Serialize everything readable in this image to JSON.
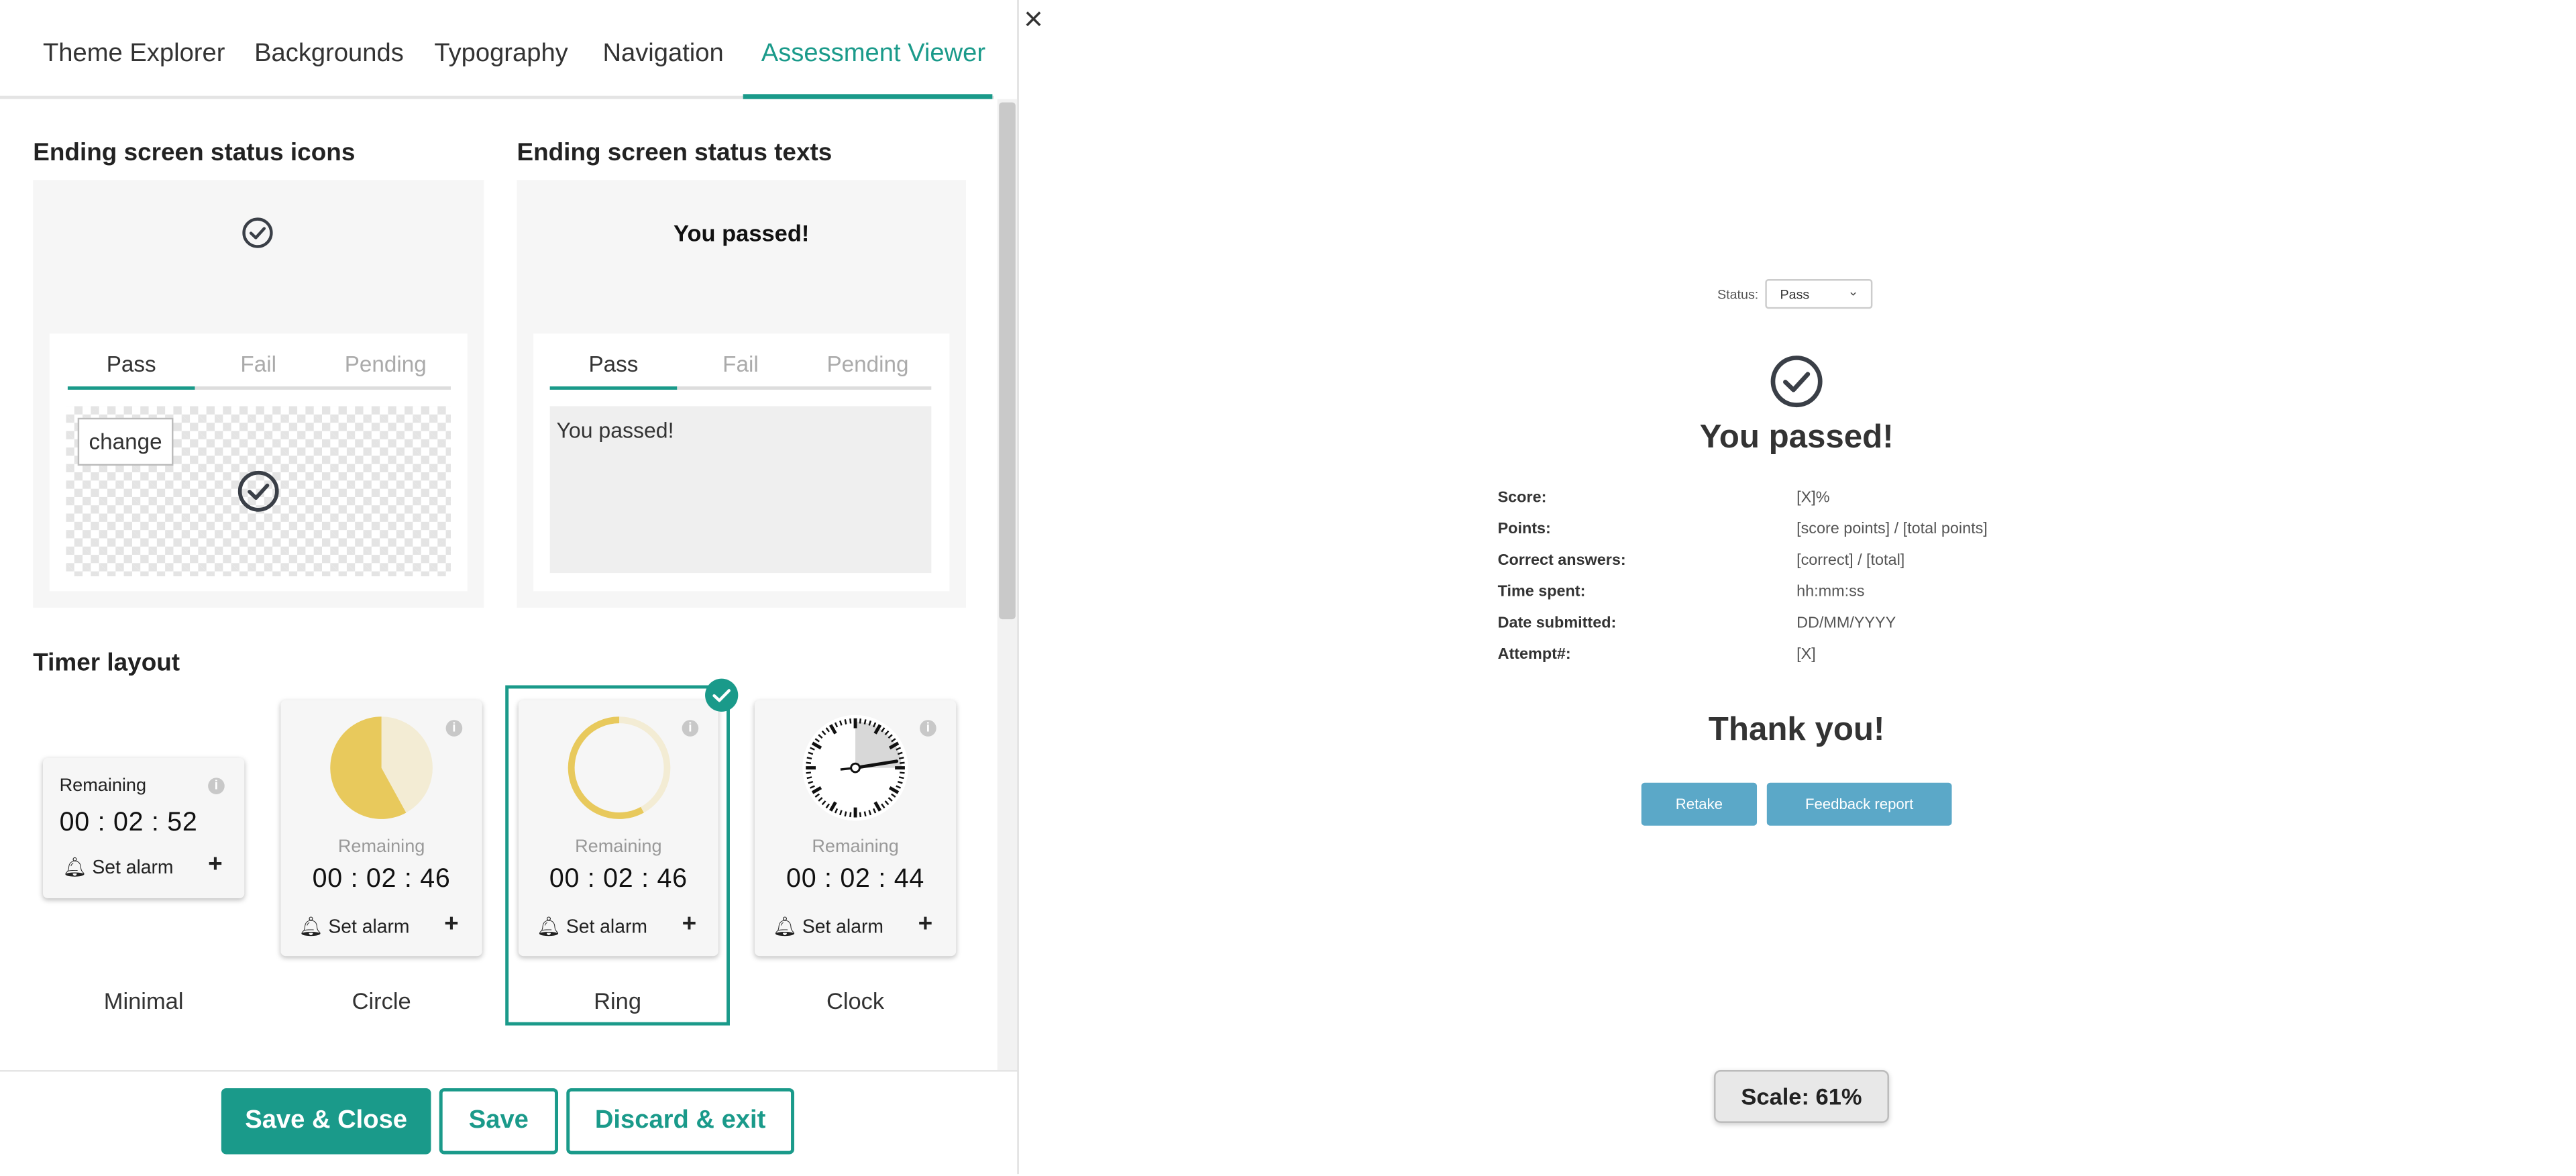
{
  "tabs": [
    "Theme Explorer",
    "Backgrounds",
    "Typography",
    "Navigation",
    "Assessment Viewer"
  ],
  "active_tab": "Assessment Viewer",
  "close_icon": "×",
  "status_icons": {
    "title": "Ending screen status icons",
    "subtabs": [
      "Pass",
      "Fail",
      "Pending"
    ],
    "active_subtab": "Pass",
    "change_label": "change"
  },
  "status_texts": {
    "title": "Ending screen status texts",
    "preview_text": "You passed!",
    "subtabs": [
      "Pass",
      "Fail",
      "Pending"
    ],
    "active_subtab": "Pass",
    "text_value": "You passed!"
  },
  "timer": {
    "title": "Timer layout",
    "layouts": [
      {
        "name": "Minimal",
        "label": "Remaining",
        "time": "00 : 02 : 52",
        "alarm": "Set alarm"
      },
      {
        "name": "Circle",
        "label": "Remaining",
        "time": "00 : 02 : 46",
        "alarm": "Set alarm",
        "progress": 0.58
      },
      {
        "name": "Ring",
        "label": "Remaining",
        "time": "00 : 02 : 46",
        "alarm": "Set alarm",
        "progress": 0.58
      },
      {
        "name": "Clock",
        "label": "Remaining",
        "time": "00 : 02 : 44",
        "alarm": "Set alarm"
      }
    ],
    "selected": "Ring"
  },
  "footer": {
    "save_close": "Save & Close",
    "save": "Save",
    "discard": "Discard & exit"
  },
  "preview": {
    "status_label": "Status:",
    "status_value": "Pass",
    "title": "You passed!",
    "rows": [
      {
        "label": "Score:",
        "value": "[X]%"
      },
      {
        "label": "Points:",
        "value": "[score points] / [total points]"
      },
      {
        "label": "Correct answers:",
        "value": "[correct] / [total]"
      },
      {
        "label": "Time spent:",
        "value": "hh:mm:ss"
      },
      {
        "label": "Date submitted:",
        "value": "DD/MM/YYYY"
      },
      {
        "label": "Attempt#:",
        "value": "[X]"
      }
    ],
    "thanks": "Thank you!",
    "retake": "Retake",
    "feedback": "Feedback report"
  },
  "scale": "Scale: 61%",
  "colors": {
    "accent": "#1a9a8a",
    "timer_yellow": "#e8c95c",
    "preview_button": "#5ba8c8"
  }
}
